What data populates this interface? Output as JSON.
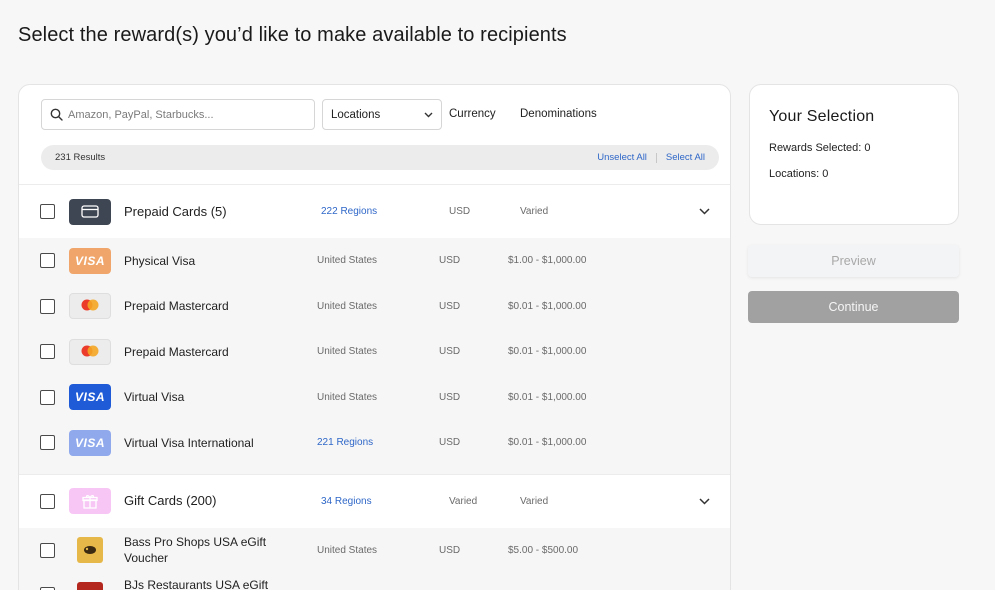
{
  "page": {
    "title": "Select the reward(s) you’d like to make available to recipients"
  },
  "filters": {
    "search_placeholder": "Amazon, PayPal, Starbucks...",
    "locations_label": "Locations",
    "currency_label": "Currency",
    "denominations_label": "Denominations"
  },
  "results": {
    "count": "231 Results",
    "unselect_all": "Unselect All",
    "select_all": "Select All"
  },
  "groups": [
    {
      "name": "Prepaid Cards (5)",
      "regions": "222 Regions",
      "currency": "USD",
      "denomination": "Varied",
      "icon": "card-icon",
      "items": [
        {
          "name": "Physical Visa",
          "region": "United States",
          "currency": "USD",
          "denomination": "$1.00 - $1,000.00",
          "icon": "visa-orange-icon"
        },
        {
          "name": "Prepaid Mastercard",
          "region": "United States",
          "currency": "USD",
          "denomination": "$0.01 - $1,000.00",
          "icon": "mastercard-icon"
        },
        {
          "name": "Prepaid Mastercard",
          "region": "United States",
          "currency": "USD",
          "denomination": "$0.01 - $1,000.00",
          "icon": "mastercard-icon"
        },
        {
          "name": "Virtual Visa",
          "region": "United States",
          "currency": "USD",
          "denomination": "$0.01 - $1,000.00",
          "icon": "visa-blue-icon"
        },
        {
          "name": "Virtual Visa International",
          "region": "221 Regions",
          "currency": "USD",
          "denomination": "$0.01 - $1,000.00",
          "icon": "visa-light-icon"
        }
      ]
    },
    {
      "name": "Gift Cards (200)",
      "regions": "34 Regions",
      "currency": "Varied",
      "denomination": "Varied",
      "icon": "gift-icon",
      "items": [
        {
          "name": "Bass Pro Shops USA eGift Voucher",
          "region": "United States",
          "currency": "USD",
          "denomination": "$5.00 - $500.00",
          "icon": "bass-pro-icon"
        },
        {
          "name": "BJs Restaurants USA eGift",
          "region": "",
          "currency": "",
          "denomination": "",
          "icon": "bjs-icon"
        }
      ]
    }
  ],
  "selection": {
    "title": "Your Selection",
    "rewards_selected": "Rewards Selected: 0",
    "locations": "Locations: 0"
  },
  "actions": {
    "preview": "Preview",
    "continue": "Continue"
  },
  "colors": {
    "link": "#2f67c8",
    "visa_orange": "#f0a66b",
    "visa_blue": "#1f5bd6",
    "visa_light": "#8fa9ec",
    "gift_pink": "#f7c6f4",
    "continue_disabled": "#a1a1a1"
  }
}
